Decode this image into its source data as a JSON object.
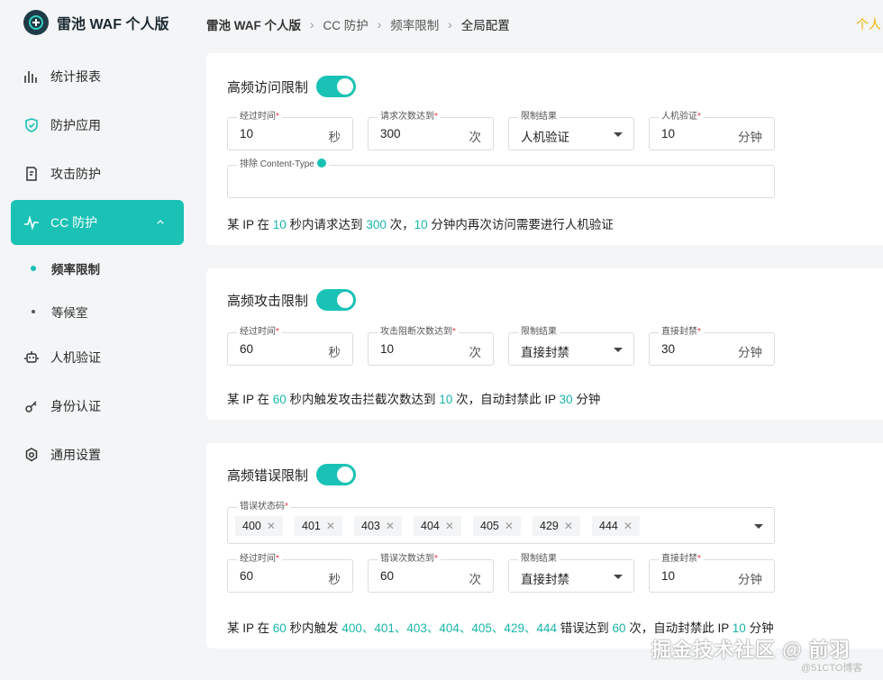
{
  "app": {
    "title": "雷池 WAF 个人版"
  },
  "header": {
    "breadcrumb": [
      "雷池 WAF 个人版",
      "CC 防护",
      "频率限制",
      "全局配置"
    ],
    "right_text": "个人"
  },
  "sidebar": {
    "items": [
      {
        "label": "统计报表",
        "icon": "bar-chart-icon"
      },
      {
        "label": "防护应用",
        "icon": "shield-icon"
      },
      {
        "label": "攻击防护",
        "icon": "document-shield-icon"
      },
      {
        "label": "CC 防护",
        "icon": "pulse-icon"
      },
      {
        "label": "频率限制",
        "sub": true
      },
      {
        "label": "等候室",
        "sub": true
      },
      {
        "label": "人机验证",
        "icon": "robot-icon"
      },
      {
        "label": "身份认证",
        "icon": "key-icon"
      },
      {
        "label": "通用设置",
        "icon": "gear-icon"
      }
    ]
  },
  "cards": {
    "access": {
      "title": "高频访问限制",
      "time": {
        "label": "经过时间",
        "value": "10",
        "unit": "秒"
      },
      "count": {
        "label": "请求次数达到",
        "value": "300",
        "unit": "次"
      },
      "result": {
        "label": "限制结果",
        "value": "人机验证"
      },
      "duration": {
        "label": "人机验证",
        "value": "10",
        "unit": "分钟"
      },
      "exclude": {
        "label": "排除 Content-Type",
        "value": ""
      },
      "summary": {
        "p1": "某 IP 在 ",
        "v1": "10",
        "p2": " 秒内请求达到 ",
        "v2": "300",
        "p3": " 次，",
        "v3": "10",
        "p4": " 分钟内再次访问需要进行人机验证"
      }
    },
    "attack": {
      "title": "高频攻击限制",
      "time": {
        "label": "经过时间",
        "value": "60",
        "unit": "秒"
      },
      "count": {
        "label": "攻击阻断次数达到",
        "value": "10",
        "unit": "次"
      },
      "result": {
        "label": "限制结果",
        "value": "直接封禁"
      },
      "duration": {
        "label": "直接封禁",
        "value": "30",
        "unit": "分钟"
      },
      "summary": {
        "p1": "某 IP 在 ",
        "v1": "60",
        "p2": " 秒内触发攻击拦截次数达到 ",
        "v2": "10",
        "p3": " 次，自动封禁此 IP ",
        "v3": "30",
        "p4": " 分钟"
      }
    },
    "error": {
      "title": "高频错误限制",
      "codes_label": "错误状态码",
      "codes": [
        "400",
        "401",
        "403",
        "404",
        "405",
        "429",
        "444"
      ],
      "time": {
        "label": "经过时间",
        "value": "60",
        "unit": "秒"
      },
      "count": {
        "label": "错误次数达到",
        "value": "60",
        "unit": "次"
      },
      "result": {
        "label": "限制结果",
        "value": "直接封禁"
      },
      "duration": {
        "label": "直接封禁",
        "value": "10",
        "unit": "分钟"
      },
      "summary": {
        "p1": "某 IP 在 ",
        "v1": "60",
        "p2": " 秒内触发 ",
        "v2": "400、401、403、404、405、429、444",
        "p3": " 错误达到 ",
        "v3": "60",
        "p4": " 次，自动封禁此 IP ",
        "v4": "10",
        "p5": " 分钟"
      }
    }
  },
  "watermark": {
    "text": "掘金技术社区 @ 前羽",
    "sub": "@51CTO博客"
  },
  "colors": {
    "accent": "#19c2b5",
    "highlight": "#19b6aa",
    "warning": "#f0b400"
  }
}
